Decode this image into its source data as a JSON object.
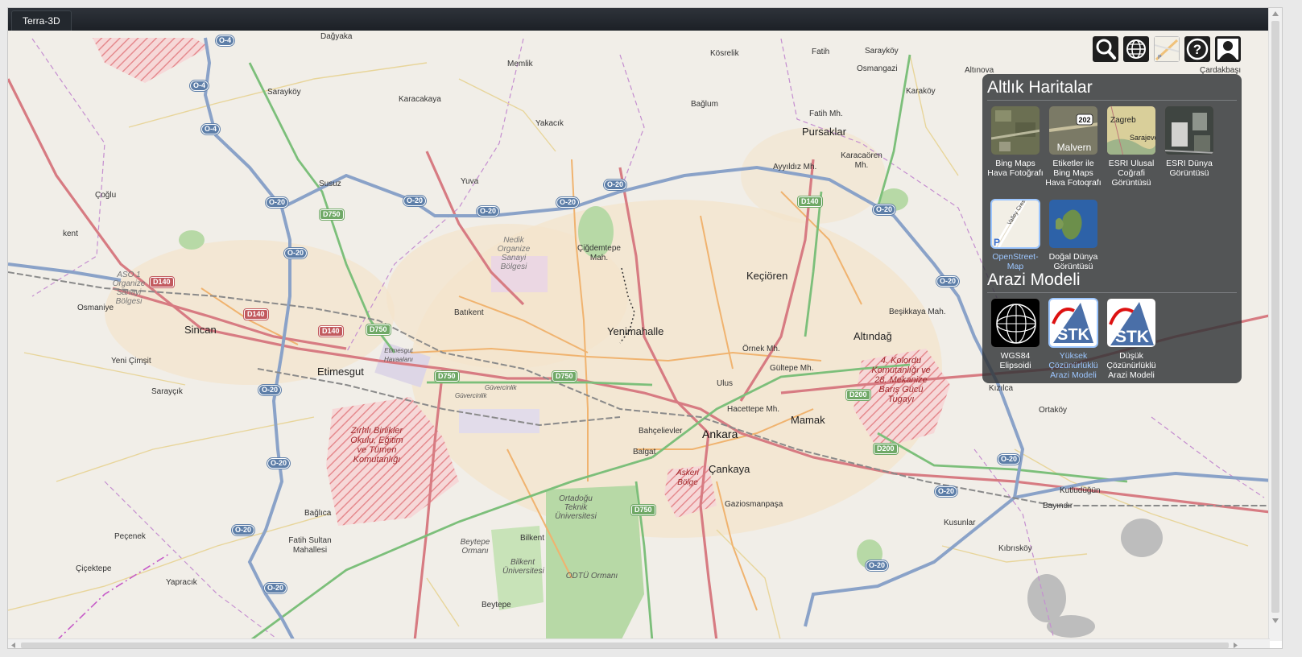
{
  "window": {
    "tab_label": "Terra-3D"
  },
  "toolbar": [
    {
      "name": "search-button",
      "icon": "search-icon"
    },
    {
      "name": "globe-button",
      "icon": "globe-icon"
    },
    {
      "name": "basemap-button",
      "icon": "map-thumbnail-icon"
    },
    {
      "name": "help-button",
      "icon": "help-icon"
    },
    {
      "name": "user-button",
      "icon": "user-icon"
    }
  ],
  "panel": {
    "basemaps_title": "Altlık Haritalar",
    "terrain_title": "Arazi Modeli",
    "basemaps": [
      {
        "label": "Bing Maps Hava Fotoğrafı",
        "thumb": "aerial",
        "selected": false
      },
      {
        "label": "Etiketler ile Bing Maps Hava Fotoqrafı",
        "thumb": "aerial-labels",
        "selected": false,
        "thumb_text": "Malvern",
        "thumb_badge": "202"
      },
      {
        "label": "ESRI Ulusal Coğrafi Görüntüsü",
        "thumb": "natgeo",
        "selected": false,
        "thumb_text": "Zagreb",
        "thumb_text2": "Sarajevo"
      },
      {
        "label": "ESRI Dünya Görüntüsü",
        "thumb": "esri-imagery",
        "selected": false
      },
      {
        "label": "OpenStreet-Map",
        "thumb": "osm",
        "selected": true,
        "thumb_text": "Valley Crest Blvd"
      },
      {
        "label": "Doğal Dünya Görüntüsü",
        "thumb": "natural-earth",
        "selected": false
      }
    ],
    "terrain": [
      {
        "label": "WGS84 Elipsoidi",
        "thumb": "wgs84",
        "selected": false
      },
      {
        "label": "Yüksek Çözünürlüklü Arazi Modeli",
        "thumb": "stk-high",
        "selected": true,
        "thumb_text": "STK"
      },
      {
        "label": "Düşük Çözünürlüklü Arazi Modeli",
        "thumb": "stk-low",
        "selected": false,
        "thumb_text": "STK"
      }
    ]
  },
  "map": {
    "places": [
      "Dağyaka",
      "Memlik",
      "Kösrelik",
      "Fatih",
      "Sarayköy",
      "Osmangazi",
      "Altınova",
      "Çardakbaşı",
      "Sarayköy",
      "Karacakaya",
      "Bağlum",
      "Karaköy",
      "Fatih Mh.",
      "Yakacık",
      "Pursaklar",
      "Karacaören Mh.",
      "Ayyıldız Mh.",
      "Susuz",
      "Yuva",
      "Çoğlu",
      "kent",
      "ASO 1 Organize Sanayi Bölgesi",
      "Osmaniye",
      "Sincan",
      "Yeni Çimşit",
      "Sarayçık",
      "Etimesgut",
      "Batıkent",
      "Çiğdemtepe Mah.",
      "Keçiören",
      "Yenimahalle",
      "Altındağ",
      "Beşikkaya Mah.",
      "Örnek Mh.",
      "Gültepe Mh.",
      "Ulus",
      "Hacettepe Mh.",
      "Mamak",
      "Kızılca",
      "Ortaköy",
      "Bahçelievler",
      "Ankara",
      "Balgat",
      "Çankaya",
      "Gaziosmanpaşa",
      "Kutludüğün",
      "Bayındır",
      "Kusunlar",
      "Kıbrısköy",
      "Bağlıca",
      "Peçenek",
      "Fatih Sultan Mahallesi",
      "Çiçektepe",
      "Yapracık",
      "Bilkent",
      "Beytepe",
      "Etimesgut Havaalanı",
      "Güvercinlik",
      "Güvercinlik"
    ],
    "military_areas": [
      "Zırhlı Birlikler Okulu, Eğitim ve Tümen Komutanlığı",
      "4. Kolordu Komutanlığı ve 28. Mekanize Barış Gücü Tugayı",
      "Askeri Bölge"
    ],
    "parks": [
      "Ortadoğu Teknik Üniversitesi",
      "ODTÜ Ormanı",
      "Beytepe Ormanı",
      "Bilkent Üniversitesi"
    ],
    "industrial": [
      "Nedik Organize Sanayi Bölgesi"
    ],
    "road_shields": [
      "O-4",
      "O-4",
      "O-4",
      "O-20",
      "O-20",
      "O-20",
      "O-20",
      "O-20",
      "O-20",
      "O-20",
      "O-20",
      "O-20",
      "O-20",
      "O-20",
      "O-20",
      "O-20",
      "O-20",
      "O-20",
      "D750",
      "D750",
      "D750",
      "D750",
      "D750",
      "D140",
      "D140",
      "D140",
      "D140",
      "D200",
      "D200"
    ]
  },
  "colors": {
    "panel_bg": "#303336",
    "selected_caption": "#9cc6ff",
    "map_bg": "#f1eee8",
    "tab_bar": "#1c2026"
  }
}
